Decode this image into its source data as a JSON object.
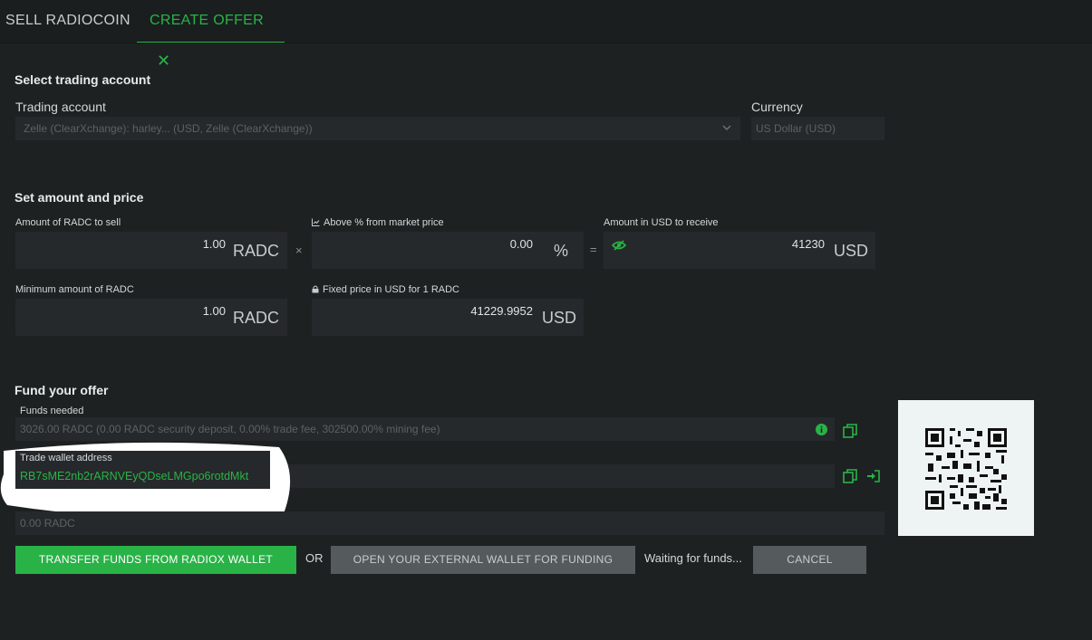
{
  "tabs": {
    "sell": "SELL RADIOCOIN",
    "create": "CREATE OFFER",
    "close_icon": "close-icon"
  },
  "account_section": {
    "title": "Select trading account",
    "trading_account_label": "Trading account",
    "trading_account_value": "Zelle (ClearXchange): harley... (USD, Zelle (ClearXchange))",
    "currency_label": "Currency",
    "currency_value": "US Dollar (USD)"
  },
  "amount_section": {
    "title": "Set amount and price",
    "amount_label": "Amount of RADC to sell",
    "amount_value": "1.00",
    "amount_unit": "RADC",
    "times_symbol": "×",
    "above_label": "Above % from market price",
    "above_value": "0.00",
    "above_unit": "%",
    "equals_symbol": "=",
    "receive_label": "Amount in USD to receive",
    "receive_value": "41230",
    "receive_unit": "USD",
    "min_label": "Minimum amount of RADC",
    "min_value": "1.00",
    "min_unit": "RADC",
    "fixed_label": "Fixed price in USD for 1 RADC",
    "fixed_value": "41229.9952",
    "fixed_unit": "USD"
  },
  "fund_section": {
    "title": "Fund your offer",
    "funds_needed_label": "Funds needed",
    "funds_needed_value": "3026.00 RADC (0.00 RADC security deposit, 0.00% trade fee, 302500.00% mining fee)",
    "wallet_label": "Trade wallet address",
    "wallet_value": "RB7sME2nb2rARNVEyQDseLMGpo6rotdMkt",
    "balance_value": "0.00 RADC"
  },
  "actions": {
    "transfer": "TRANSFER FUNDS FROM RADIOX WALLET",
    "or": "OR",
    "external": "OPEN YOUR EXTERNAL WALLET FOR FUNDING",
    "waiting": "Waiting for funds...",
    "cancel": "CANCEL"
  },
  "colors": {
    "accent": "#29b347",
    "background": "#1d2122",
    "field": "#26292b"
  }
}
